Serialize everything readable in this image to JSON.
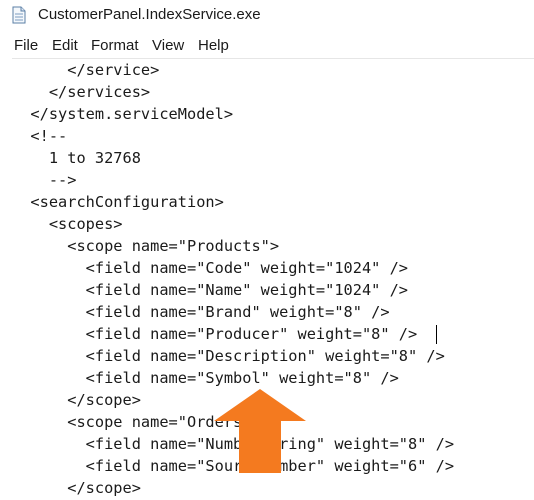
{
  "window": {
    "title": "CustomerPanel.IndexService.exe",
    "title_icon": "notepad-icon"
  },
  "menu": [
    "File",
    "Edit",
    "Format",
    "View",
    "Help"
  ],
  "editor": {
    "lines": [
      "      </service>",
      "    </services>",
      "  </system.serviceModel>",
      "  <!--",
      "    1 to 32768",
      "    -->",
      "  <searchConfiguration>",
      "    <scopes>",
      "      <scope name=\"Products\">",
      "        <field name=\"Code\" weight=\"1024\" />",
      "        <field name=\"Name\" weight=\"1024\" />",
      "        <field name=\"Brand\" weight=\"8\" />",
      "        <field name=\"Producer\" weight=\"8\" />",
      "        <field name=\"Description\" weight=\"8\" />",
      "        <field name=\"Symbol\" weight=\"8\" />",
      "      </scope>",
      "      <scope name=\"Orders\">",
      "        <field name=\"NumberString\" weight=\"8\" />",
      "        <field name=\"SourceNumber\" weight=\"6\" />",
      "      </scope>"
    ],
    "caret_line": 12
  },
  "overlay": {
    "arrow_icon": "up-arrow-icon",
    "arrow_color": "#F47A1F"
  }
}
